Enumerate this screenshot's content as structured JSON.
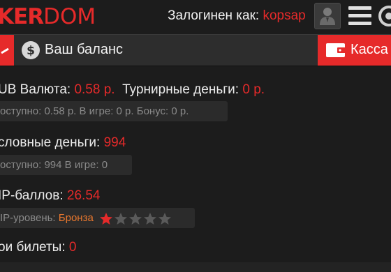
{
  "header": {
    "logo_bold": "KER",
    "logo_light": "DOM",
    "logged_label": "Залогинен как:",
    "username": "kopsap"
  },
  "balance": {
    "title": "Ваш баланс",
    "cashier_label": "Касса"
  },
  "rub": {
    "label": "UB Валюта:",
    "value": "0.58 р.",
    "tournament_label": "Турнирные деньги:",
    "tournament_value": "0 р.",
    "details": "оступно: 0.58 р.  В игре: 0 р.  Бонус: 0 р."
  },
  "play": {
    "label": "словные деньги:",
    "value": "994",
    "details": "оступно: 994  В игре: 0"
  },
  "vip": {
    "label": "IP-баллов:",
    "value": "26.54",
    "level_label": "IP-уровень:",
    "level_value": "Бронза",
    "stars_filled": 1,
    "stars_total": 5
  },
  "tickets": {
    "label": "ои билеты:",
    "value": "0"
  },
  "colors": {
    "accent": "#e62a2a",
    "background": "#1c1c1c",
    "bar": "#2d2d2d",
    "level": "#e8772e"
  },
  "icons": [
    "user-silhouette-icon",
    "hamburger-menu-icon",
    "coin-icon",
    "wallet-icon",
    "star-icon"
  ]
}
